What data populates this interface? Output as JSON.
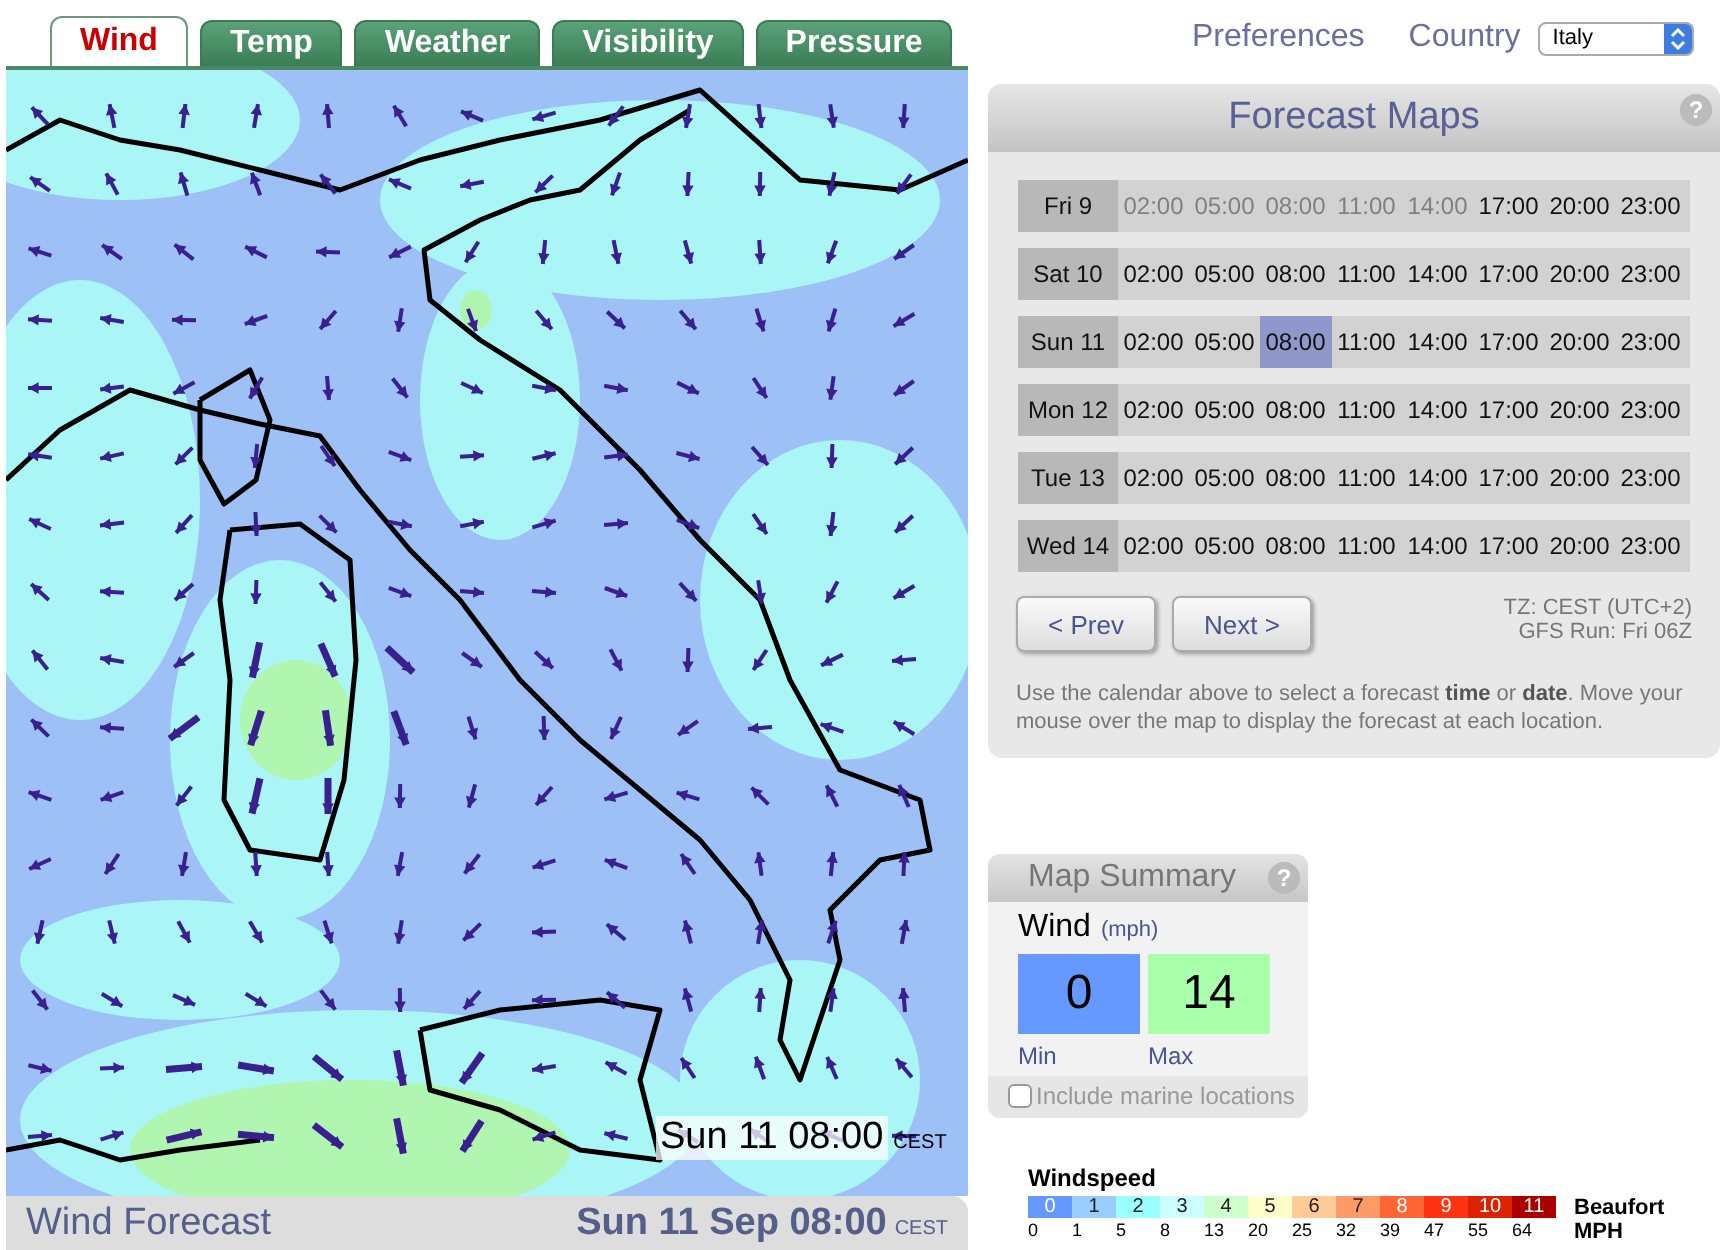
{
  "tabs": [
    {
      "label": "Wind",
      "selected": true
    },
    {
      "label": "Temp",
      "selected": false
    },
    {
      "label": "Weather",
      "selected": false
    },
    {
      "label": "Visibility",
      "selected": false
    },
    {
      "label": "Pressure",
      "selected": false
    }
  ],
  "preferences": "Preferences",
  "country": {
    "label": "Country",
    "value": "Italy"
  },
  "map_overlay": {
    "time": "Sun 11 08:00",
    "tz": "CEST"
  },
  "map_footer": {
    "title": "Wind Forecast",
    "datetime": "Sun 11 Sep 08:00",
    "tz": "CEST"
  },
  "forecast": {
    "title": "Forecast Maps",
    "help": "?",
    "days": [
      {
        "label": "Fri 9",
        "times": [
          {
            "label": "02:00",
            "available": false,
            "selected": false
          },
          {
            "label": "05:00",
            "available": false,
            "selected": false
          },
          {
            "label": "08:00",
            "available": false,
            "selected": false
          },
          {
            "label": "11:00",
            "available": false,
            "selected": false
          },
          {
            "label": "14:00",
            "available": false,
            "selected": false
          },
          {
            "label": "17:00",
            "available": true,
            "selected": false
          },
          {
            "label": "20:00",
            "available": true,
            "selected": false
          },
          {
            "label": "23:00",
            "available": true,
            "selected": false
          }
        ]
      },
      {
        "label": "Sat 10",
        "times": [
          {
            "label": "02:00",
            "available": true,
            "selected": false
          },
          {
            "label": "05:00",
            "available": true,
            "selected": false
          },
          {
            "label": "08:00",
            "available": true,
            "selected": false
          },
          {
            "label": "11:00",
            "available": true,
            "selected": false
          },
          {
            "label": "14:00",
            "available": true,
            "selected": false
          },
          {
            "label": "17:00",
            "available": true,
            "selected": false
          },
          {
            "label": "20:00",
            "available": true,
            "selected": false
          },
          {
            "label": "23:00",
            "available": true,
            "selected": false
          }
        ]
      },
      {
        "label": "Sun 11",
        "times": [
          {
            "label": "02:00",
            "available": true,
            "selected": false
          },
          {
            "label": "05:00",
            "available": true,
            "selected": false
          },
          {
            "label": "08:00",
            "available": true,
            "selected": true
          },
          {
            "label": "11:00",
            "available": true,
            "selected": false
          },
          {
            "label": "14:00",
            "available": true,
            "selected": false
          },
          {
            "label": "17:00",
            "available": true,
            "selected": false
          },
          {
            "label": "20:00",
            "available": true,
            "selected": false
          },
          {
            "label": "23:00",
            "available": true,
            "selected": false
          }
        ]
      },
      {
        "label": "Mon 12",
        "times": [
          {
            "label": "02:00",
            "available": true,
            "selected": false
          },
          {
            "label": "05:00",
            "available": true,
            "selected": false
          },
          {
            "label": "08:00",
            "available": true,
            "selected": false
          },
          {
            "label": "11:00",
            "available": true,
            "selected": false
          },
          {
            "label": "14:00",
            "available": true,
            "selected": false
          },
          {
            "label": "17:00",
            "available": true,
            "selected": false
          },
          {
            "label": "20:00",
            "available": true,
            "selected": false
          },
          {
            "label": "23:00",
            "available": true,
            "selected": false
          }
        ]
      },
      {
        "label": "Tue 13",
        "times": [
          {
            "label": "02:00",
            "available": true,
            "selected": false
          },
          {
            "label": "05:00",
            "available": true,
            "selected": false
          },
          {
            "label": "08:00",
            "available": true,
            "selected": false
          },
          {
            "label": "11:00",
            "available": true,
            "selected": false
          },
          {
            "label": "14:00",
            "available": true,
            "selected": false
          },
          {
            "label": "17:00",
            "available": true,
            "selected": false
          },
          {
            "label": "20:00",
            "available": true,
            "selected": false
          },
          {
            "label": "23:00",
            "available": true,
            "selected": false
          }
        ]
      },
      {
        "label": "Wed 14",
        "times": [
          {
            "label": "02:00",
            "available": true,
            "selected": false
          },
          {
            "label": "05:00",
            "available": true,
            "selected": false
          },
          {
            "label": "08:00",
            "available": true,
            "selected": false
          },
          {
            "label": "11:00",
            "available": true,
            "selected": false
          },
          {
            "label": "14:00",
            "available": true,
            "selected": false
          },
          {
            "label": "17:00",
            "available": true,
            "selected": false
          },
          {
            "label": "20:00",
            "available": true,
            "selected": false
          },
          {
            "label": "23:00",
            "available": true,
            "selected": false
          }
        ]
      }
    ],
    "prev": "< Prev",
    "next": "Next >",
    "tz": "TZ: CEST (UTC+2)",
    "gfs_run": "GFS Run: Fri 06Z",
    "help_text": "Use the calendar above to select a forecast **time** or **date**. Move your mouse over the map to display the forecast at each location."
  },
  "summary": {
    "title": "Map Summary",
    "help": "?",
    "variable": "Wind",
    "unit": "(mph)",
    "min": {
      "value": "0",
      "label": "Min",
      "color": "#6699ff"
    },
    "max": {
      "value": "14",
      "label": "Max",
      "color": "#aaffaa"
    },
    "marine": {
      "label": "Include marine locations",
      "checked": false
    }
  },
  "legend": {
    "title": "Windspeed",
    "scale_label": "Beaufort",
    "speed_label": "MPH",
    "beaufort": [
      {
        "label": "0",
        "color": "#6699ff"
      },
      {
        "label": "1",
        "color": "#99ccff"
      },
      {
        "label": "2",
        "color": "#99ffff"
      },
      {
        "label": "3",
        "color": "#ccffff"
      },
      {
        "label": "4",
        "color": "#ccffcc"
      },
      {
        "label": "5",
        "color": "#ffffcc"
      },
      {
        "label": "6",
        "color": "#ffcc99"
      },
      {
        "label": "7",
        "color": "#ff9966"
      },
      {
        "label": "8",
        "color": "#ff6633"
      },
      {
        "label": "9",
        "color": "#ff3311"
      },
      {
        "label": "10",
        "color": "#dd2200"
      },
      {
        "label": "11",
        "color": "#aa0000"
      }
    ],
    "speeds": [
      "0",
      "1",
      "5",
      "8",
      "13",
      "20",
      "25",
      "32",
      "39",
      "47",
      "55",
      "64"
    ]
  }
}
